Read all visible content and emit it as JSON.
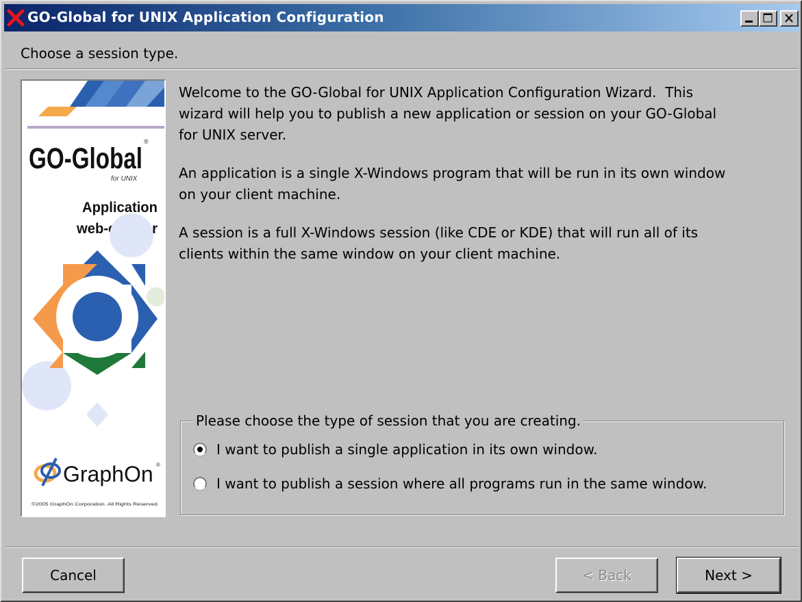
{
  "window": {
    "title": "GO-Global for UNIX Application Configuration",
    "icon": "graphon-x-icon",
    "controls": [
      "minimize-icon",
      "maximize-icon",
      "close-icon"
    ]
  },
  "header": {
    "subtitle": "Choose a session type."
  },
  "banner": {
    "logo_text": "GO-Global",
    "tm": "®",
    "for_text": "for UNIX",
    "tagline_1": "Application",
    "tagline_2": "web-enabler",
    "company": "GraphOn",
    "company_tm": "®",
    "copyright": "©2005 GraphOn Corporation. All Rights Reserved."
  },
  "content": {
    "paragraphs": [
      "Welcome to the GO-Global for UNIX Application Configuration Wizard.  This\nwizard will help you to publish a new application or session on your GO-Global\nfor UNIX server.",
      "An application is a single X-Windows program that will be run in its own window\non your client machine.",
      "A session is a full X-Windows session (like CDE or KDE) that will run all of its\nclients within the same window on your client machine."
    ]
  },
  "session_type": {
    "legend": "Please choose the type of session that you are creating.",
    "options": [
      {
        "label": "I want to publish a single application in its own window.",
        "selected": true
      },
      {
        "label": "I want to publish a session where all programs run in the same window.",
        "selected": false
      }
    ]
  },
  "buttons": {
    "cancel": "Cancel",
    "back": "< Back",
    "next": "Next >"
  },
  "colors": {
    "titlebar_start": "#0a246a",
    "titlebar_end": "#a6caf0",
    "face": "#c0c0c0",
    "logo_blue": "#2b5fb0",
    "logo_orange": "#f59a4a",
    "logo_green": "#1f7a3a"
  }
}
